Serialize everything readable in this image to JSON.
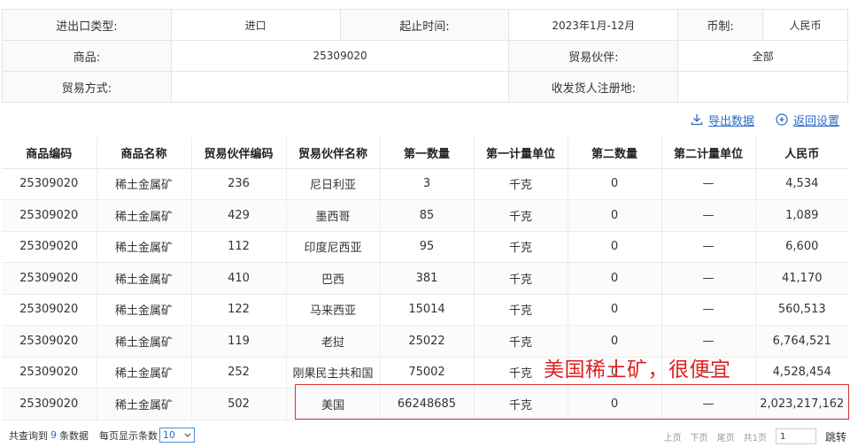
{
  "query": {
    "rows": [
      [
        {
          "text": "进出口类型:",
          "type": "lbl"
        },
        {
          "text": "进口",
          "type": "val"
        },
        {
          "text": "起止时间:",
          "type": "lbl"
        },
        {
          "text": "2023年1月-12月",
          "type": "val"
        },
        {
          "text": "币制:",
          "type": "lbl"
        },
        {
          "text": "人民币",
          "type": "val"
        }
      ],
      [
        {
          "text": "商品:",
          "type": "lbl"
        },
        {
          "text": "25309020",
          "type": "val"
        },
        {
          "text": "贸易伙伴:",
          "type": "lbl"
        },
        {
          "text": "全部",
          "type": "val"
        }
      ],
      [
        {
          "text": "贸易方式:",
          "type": "lbl"
        },
        {
          "text": "",
          "type": "val"
        },
        {
          "text": "收发货人注册地:",
          "type": "lbl"
        },
        {
          "text": "",
          "type": "val"
        }
      ]
    ]
  },
  "toolbar": {
    "export_label": "导出数据",
    "back_label": "返回设置"
  },
  "table": {
    "headers": [
      "商品编码",
      "商品名称",
      "贸易伙伴编码",
      "贸易伙伴名称",
      "第一数量",
      "第一计量单位",
      "第二数量",
      "第二计量单位",
      "人民币"
    ],
    "rows": [
      [
        "25309020",
        "稀土金属矿",
        "236",
        "尼日利亚",
        "3",
        "千克",
        "0",
        "—",
        "4,534"
      ],
      [
        "25309020",
        "稀土金属矿",
        "429",
        "墨西哥",
        "85",
        "千克",
        "0",
        "—",
        "1,089"
      ],
      [
        "25309020",
        "稀土金属矿",
        "112",
        "印度尼西亚",
        "95",
        "千克",
        "0",
        "—",
        "6,600"
      ],
      [
        "25309020",
        "稀土金属矿",
        "410",
        "巴西",
        "381",
        "千克",
        "0",
        "—",
        "41,170"
      ],
      [
        "25309020",
        "稀土金属矿",
        "122",
        "马来西亚",
        "15014",
        "千克",
        "0",
        "—",
        "560,513"
      ],
      [
        "25309020",
        "稀土金属矿",
        "119",
        "老挝",
        "25022",
        "千克",
        "0",
        "—",
        "6,764,521"
      ],
      [
        "25309020",
        "稀土金属矿",
        "252",
        "刚果民主共和国",
        "75002",
        "千克",
        "0",
        "—",
        "4,528,454"
      ],
      [
        "25309020",
        "稀土金属矿",
        "502",
        "美国",
        "66248685",
        "千克",
        "0",
        "—",
        "2,023,217,162"
      ]
    ]
  },
  "annotation": "美国稀土矿，很便宜",
  "footer": {
    "total_prefix": "共查询到",
    "total_count": "9",
    "total_suffix": "条数据",
    "per_page_label": "每页显示条数",
    "per_page_value": "10",
    "prev": "上页",
    "next": "下页",
    "last": "尾页",
    "total_pages": "共1页",
    "page_value": "1",
    "jump": "跳转"
  },
  "colors": {
    "link": "#2b6cc4",
    "annotation": "#e02020"
  }
}
